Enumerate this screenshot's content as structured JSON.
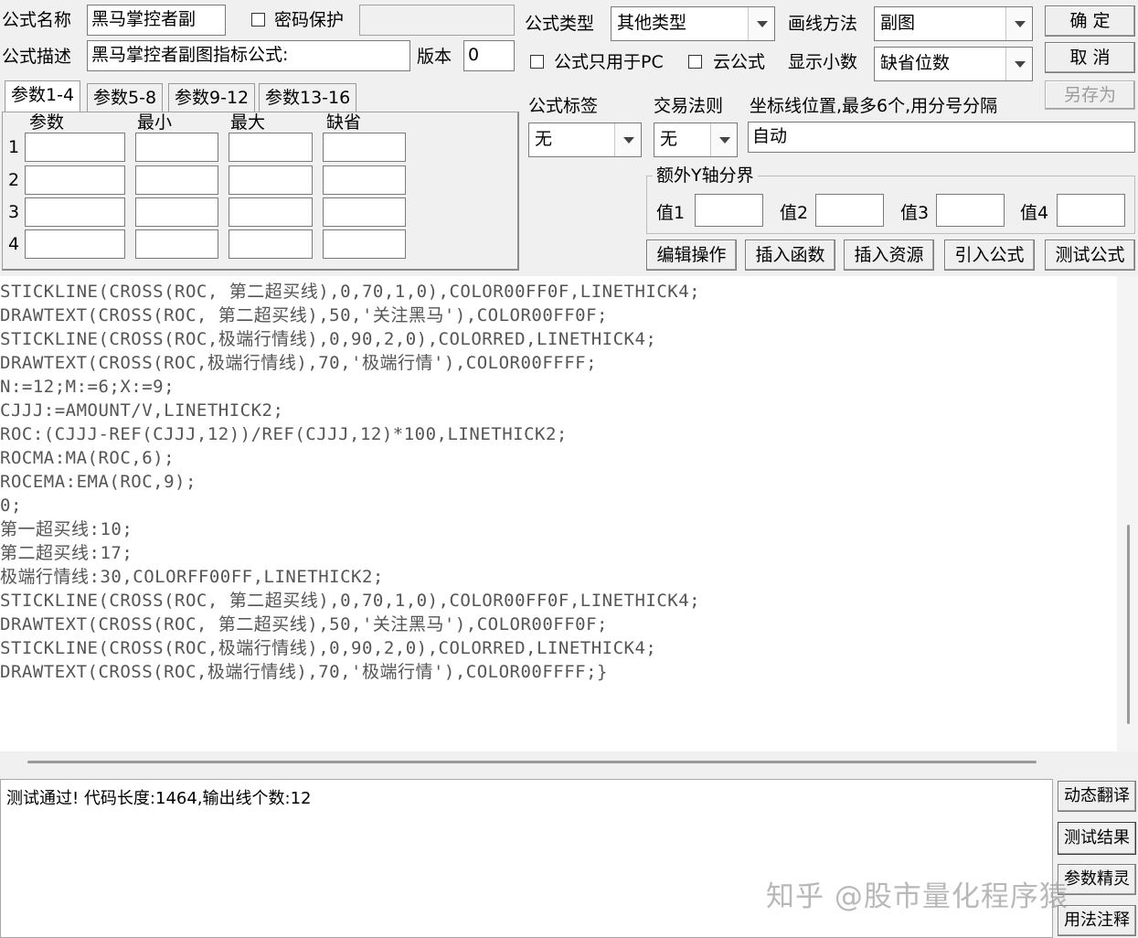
{
  "formula": {
    "name_label": "公式名称",
    "name_value": "黑马掌控者副",
    "password_label": "密码保护",
    "desc_label": "公式描述",
    "desc_value": "黑马掌控者副图指标公式:",
    "version_label": "版本",
    "version_value": "0",
    "type_label": "公式类型",
    "type_value": "其他类型",
    "draw_label": "画线方法",
    "draw_value": "副图",
    "pc_only_label": "公式只用于PC",
    "cloud_label": "云公式",
    "decimals_label": "显示小数",
    "decimals_value": "缺省位数"
  },
  "buttons": {
    "ok": "确  定",
    "cancel": "取  消",
    "save_as": "另存为",
    "edit_ops": "编辑操作",
    "insert_func": "插入函数",
    "insert_res": "插入资源",
    "import_formula": "引入公式",
    "test_formula": "测试公式",
    "dyn_translate": "动态翻译",
    "test_result": "测试结果",
    "param_wizard": "参数精灵",
    "usage_notes": "用法注释"
  },
  "tabs": [
    "参数1-4",
    "参数5-8",
    "参数9-12",
    "参数13-16"
  ],
  "params": {
    "headers": [
      "参数",
      "最小",
      "最大",
      "缺省"
    ],
    "rows": [
      "1",
      "2",
      "3",
      "4"
    ]
  },
  "tag": {
    "label": "公式标签",
    "value": "无"
  },
  "trade": {
    "label": "交易法则",
    "value": "无"
  },
  "coord": {
    "label": "坐标线位置,最多6个,用分号分隔",
    "value": "自动"
  },
  "yaxis": {
    "title": "额外Y轴分界",
    "labels": [
      "值1",
      "值2",
      "值3",
      "值4"
    ]
  },
  "code_lines": [
    "STICKLINE(CROSS(ROC, 第二超买线),0,70,1,0),COLOR00FF0F,LINETHICK4;",
    "DRAWTEXT(CROSS(ROC, 第二超买线),50,'关注黑马'),COLOR00FF0F;",
    "STICKLINE(CROSS(ROC,极端行情线),0,90,2,0),COLORRED,LINETHICK4;",
    "DRAWTEXT(CROSS(ROC,极端行情线),70,'极端行情'),COLOR00FFFF;",
    "N:=12;M:=6;X:=9;",
    "CJJJ:=AMOUNT/V,LINETHICK2;",
    "ROC:(CJJJ-REF(CJJJ,12))/REF(CJJJ,12)*100,LINETHICK2;",
    "ROCMA:MA(ROC,6);",
    "ROCEMA:EMA(ROC,9);",
    "0;",
    "第一超买线:10;",
    "第二超买线:17;",
    "极端行情线:30,COLORFF00FF,LINETHICK2;",
    "STICKLINE(CROSS(ROC, 第二超买线),0,70,1,0),COLOR00FF0F,LINETHICK4;",
    "DRAWTEXT(CROSS(ROC, 第二超买线),50,'关注黑马'),COLOR00FF0F;",
    "STICKLINE(CROSS(ROC,极端行情线),0,90,2,0),COLORRED,LINETHICK4;",
    "DRAWTEXT(CROSS(ROC,极端行情线),70,'极端行情'),COLOR00FFFF;}"
  ],
  "status": "测试通过! 代码长度:1464,输出线个数:12",
  "watermark": "知乎 @股市量化程序猿"
}
